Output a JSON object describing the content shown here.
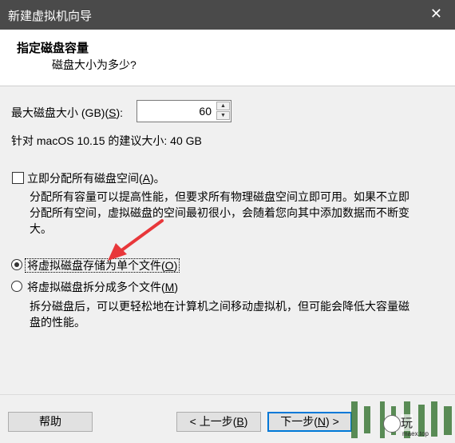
{
  "window": {
    "title": "新建虚拟机向导",
    "close_glyph": "✕"
  },
  "header": {
    "title": "指定磁盘容量",
    "subtitle": "磁盘大小为多少?"
  },
  "max_size": {
    "label_before": "最大磁盘大小 (GB)(",
    "label_key": "S",
    "label_after": "):",
    "value": "60"
  },
  "recommend": "针对 macOS 10.15 的建议大小: 40 GB",
  "allocate": {
    "label_before": "立即分配所有磁盘空间(",
    "label_key": "A",
    "label_after": ")。",
    "checked": false,
    "description_lines": [
      "分配所有容量可以提高性能，但要求所有物理磁盘空间立即可用。如果不立即",
      "分配所有空间，虚拟磁盘的空间最初很小，会随着您向其中添加数据而不断变",
      "大。"
    ]
  },
  "single_file": {
    "label_before": "将虚拟磁盘存储为单个文件(",
    "label_key": "O",
    "label_after": ")",
    "selected": true
  },
  "multi_file": {
    "label_before": "将虚拟磁盘拆分成多个文件(",
    "label_key": "M",
    "label_after": ")",
    "selected": false,
    "description_lines": [
      "拆分磁盘后，可以更轻松地在计算机之间移动虚拟机，但可能会降低大容量磁",
      "盘的性能。"
    ]
  },
  "buttons": {
    "help": "帮助",
    "back_before": "< 上一步(",
    "back_key": "B",
    "back_after": ")",
    "next_before": "下一步(",
    "next_key": "N",
    "next_after": ") >"
  },
  "watermark": {
    "line1": "玩",
    "line2": "maex.top"
  },
  "colors": {
    "arrow": "#e8373a",
    "titlebar": "#4a4a4a",
    "default_button_border": "#0078d7"
  }
}
